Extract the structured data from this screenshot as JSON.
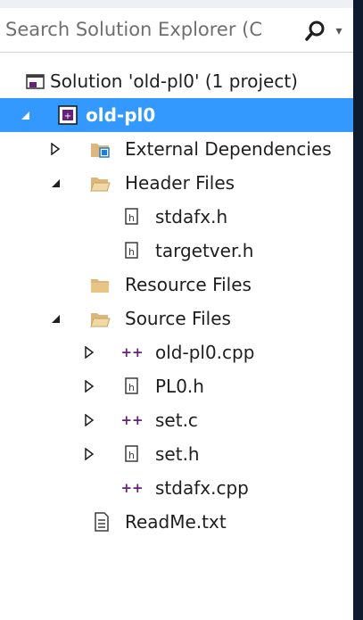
{
  "search": {
    "placeholder": "Search Solution Explorer (C",
    "dropdown_glyph": "▾"
  },
  "tree": {
    "solution_label": "Solution 'old-pl0' (1 project)",
    "project_label": "old-pl0",
    "external_deps_label": "External Dependencies",
    "header_files_label": "Header Files",
    "stdafx_h_label": "stdafx.h",
    "targetver_h_label": "targetver.h",
    "resource_files_label": "Resource Files",
    "source_files_label": "Source Files",
    "old_pl0_cpp_label": "old-pl0.cpp",
    "pl0_h_label": "PL0.h",
    "set_c_label": "set.c",
    "set_h_label": "set.h",
    "stdafx_cpp_label": "stdafx.cpp",
    "readme_label": "ReadMe.txt"
  },
  "colors": {
    "selection": "#3399ff",
    "folder": "#dcb67a",
    "cpp_plus": "#68217a",
    "right_border": "#0e1b2e"
  }
}
